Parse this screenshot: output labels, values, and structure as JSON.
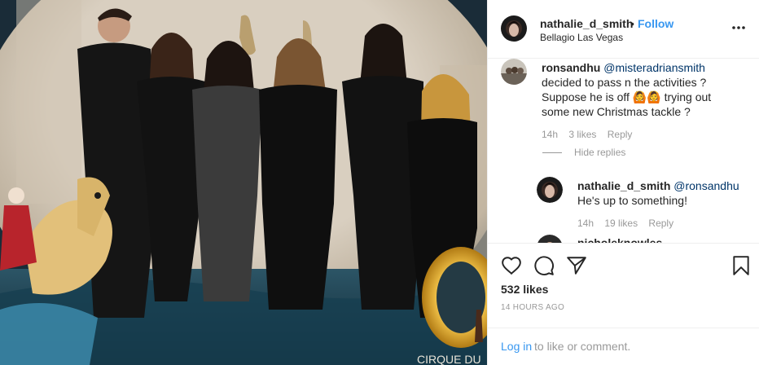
{
  "post": {
    "photo_sign_text": "CIRQUE DU",
    "photo_logo_letter": "O"
  },
  "header": {
    "username": "nathalie_d_smith",
    "separator": "•",
    "follow_label": "Follow",
    "location": "Bellagio Las Vegas"
  },
  "comments": [
    {
      "username": "ronsandhu",
      "mention": "@misteradriansmith",
      "lines": [
        "decided to pass n the activities ?",
        "Suppose he is off",
        "trying out",
        "some new Christmas tackle ?"
      ],
      "emoji": "🙆🙆",
      "time": "14h",
      "likes": "3 likes",
      "reply_label": "Reply",
      "hide_replies_label": "Hide replies"
    },
    {
      "username": "nathalie_d_smith",
      "mention": "@ronsandhu",
      "text": "He's up to something!",
      "time": "14h",
      "likes": "19 likes",
      "reply_label": "Reply"
    },
    {
      "username": "nicholeknowles"
    }
  ],
  "actions": {
    "like_icon": "heart-icon",
    "comment_icon": "comment-icon",
    "share_icon": "share-icon",
    "save_icon": "bookmark-icon",
    "likes_count": "532 likes",
    "time_ago": "14 HOURS AGO"
  },
  "footer": {
    "login_label": "Log in",
    "rest_label": "to like or comment."
  },
  "colors": {
    "link_blue": "#3897f0",
    "text": "#262626",
    "muted": "#999999",
    "border": "#efefef"
  }
}
